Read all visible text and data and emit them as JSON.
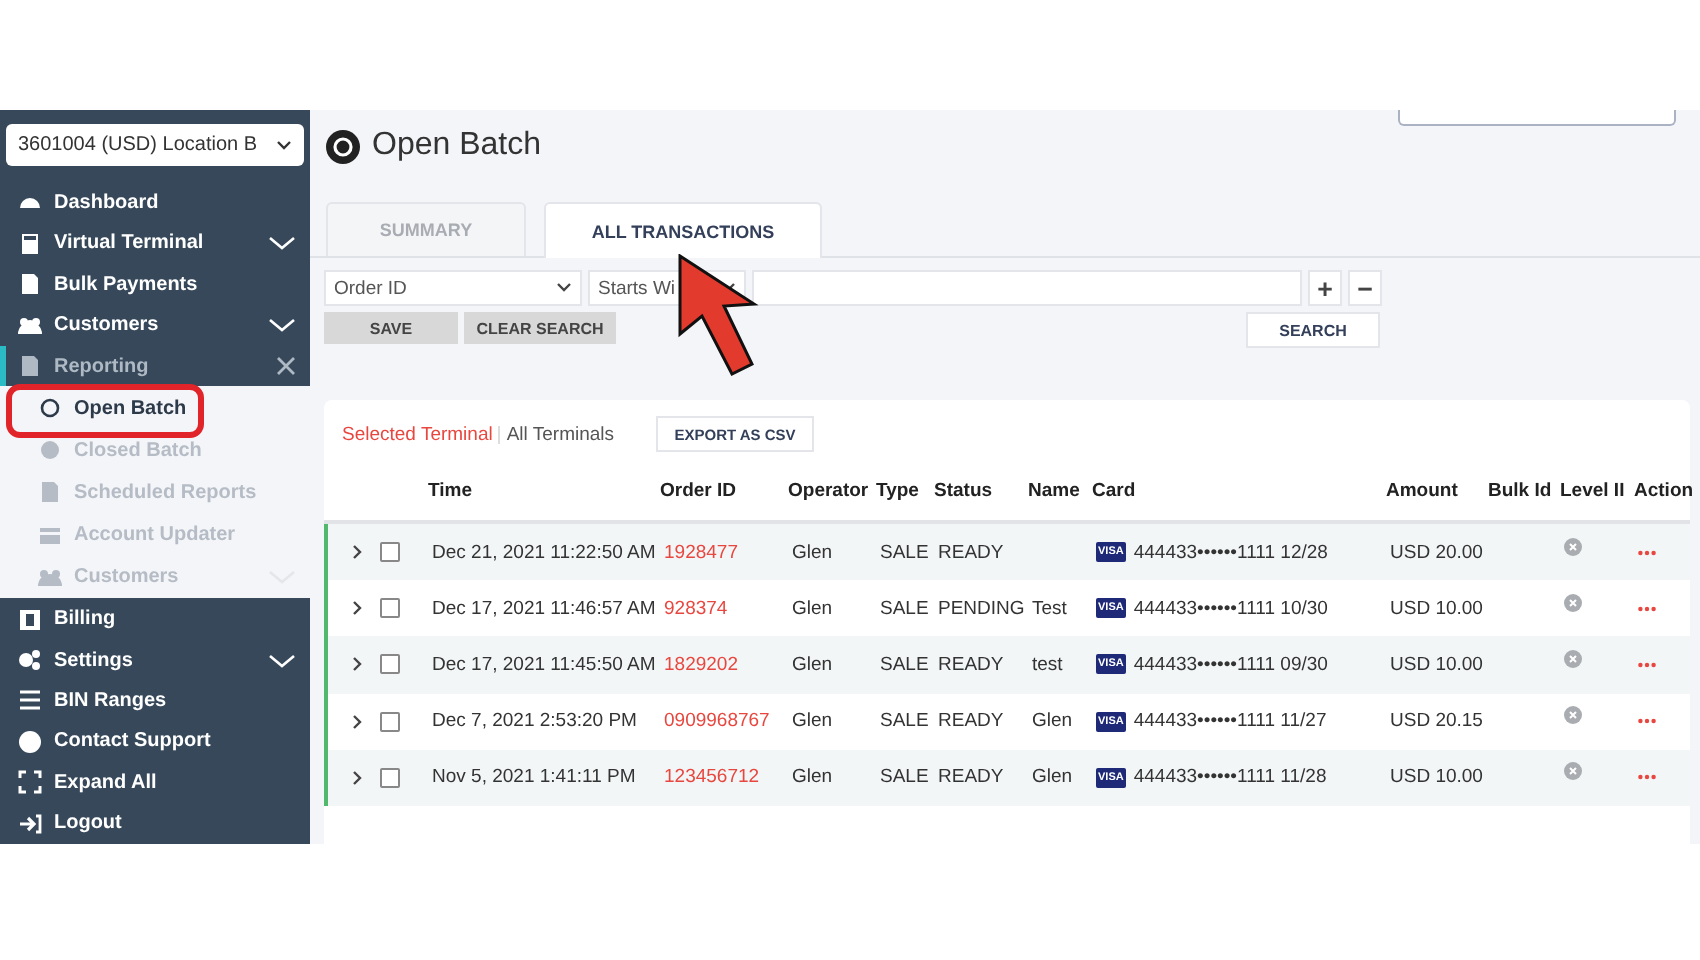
{
  "location_select": {
    "value": "3601004 (USD) Location B"
  },
  "sidebar": {
    "items": [
      {
        "label": "Dashboard",
        "selected": false,
        "expandable": false
      },
      {
        "label": "Virtual Terminal",
        "selected": false,
        "expandable": true
      },
      {
        "label": "Bulk Payments",
        "selected": false,
        "expandable": false
      },
      {
        "label": "Customers",
        "selected": false,
        "expandable": true
      },
      {
        "label": "Reporting",
        "selected": true,
        "expandable": true,
        "expanded": true,
        "children": [
          {
            "label": "Open Batch",
            "selected": true,
            "expandable": false
          },
          {
            "label": "Closed Batch",
            "selected": false,
            "expandable": false
          },
          {
            "label": "Scheduled Reports",
            "selected": false,
            "expandable": false
          },
          {
            "label": "Account Updater",
            "selected": false,
            "expandable": false
          },
          {
            "label": "Customers",
            "selected": false,
            "expandable": true
          }
        ]
      },
      {
        "label": "Billing",
        "selected": false,
        "expandable": false
      },
      {
        "label": "Settings",
        "selected": false,
        "expandable": true
      },
      {
        "label": "BIN Ranges",
        "selected": false,
        "expandable": false
      },
      {
        "label": "Contact Support",
        "selected": false,
        "expandable": false
      },
      {
        "label": "Expand All",
        "selected": false,
        "expandable": false
      },
      {
        "label": "Logout",
        "selected": false,
        "expandable": false
      }
    ]
  },
  "page_title": "Open Batch",
  "tabs": [
    {
      "label": "SUMMARY",
      "selected": false
    },
    {
      "label": "ALL TRANSACTIONS",
      "selected": true
    }
  ],
  "filter": {
    "field_select": "Order ID",
    "operator_select": "Starts Wi",
    "add_button": "+",
    "remove_button": "−",
    "save_button": "SAVE",
    "clear_button": "CLEAR SEARCH",
    "search_button": "SEARCH"
  },
  "terminal_filter": [
    {
      "label": "Selected Terminal",
      "selected": true
    },
    {
      "label": "All Terminals",
      "selected": false
    }
  ],
  "export_button": "EXPORT AS CSV",
  "table": {
    "columns": [
      "Time",
      "Order ID",
      "Operator",
      "Type",
      "Status",
      "Name",
      "Card",
      "Amount",
      "Bulk Id",
      "Level II",
      "Action"
    ],
    "rows": [
      {
        "time": "Dec 21, 2021 11:22:50 AM",
        "order_id": "1928477",
        "operator": "Glen",
        "type": "SALE",
        "status": "READY",
        "card_brand": "VISA",
        "card": "444433••••••1111 12/28",
        "amount": "USD 20.00",
        "checked": false
      },
      {
        "time": "Dec 17, 2021 11:46:57 AM",
        "order_id": "928374",
        "operator": "Glen",
        "type": "SALE",
        "status": "PENDING",
        "name": "Test",
        "card_brand": "VISA",
        "card": "444433••••••1111 10/30",
        "amount": "USD 10.00",
        "checked": false
      },
      {
        "time": "Dec 17, 2021 11:45:50 AM",
        "order_id": "1829202",
        "operator": "Glen",
        "type": "SALE",
        "status": "READY",
        "name": "test",
        "card_brand": "VISA",
        "card": "444433••••••1111 09/30",
        "amount": "USD 10.00",
        "checked": false
      },
      {
        "time": "Dec 7, 2021 2:53:20 PM",
        "order_id": "0909968767",
        "operator": "Glen",
        "type": "SALE",
        "status": "READY",
        "name": "Glen",
        "card_brand": "VISA",
        "card": "444433••••••1111 11/27",
        "amount": "USD 20.15",
        "checked": false
      },
      {
        "time": "Nov 5, 2021 1:41:11 PM",
        "order_id": "123456712",
        "operator": "Glen",
        "type": "SALE",
        "status": "READY",
        "name": "Glen",
        "card_brand": "VISA",
        "card": "444433••••••1111 11/28",
        "amount": "USD 10.00",
        "checked": false
      }
    ]
  }
}
